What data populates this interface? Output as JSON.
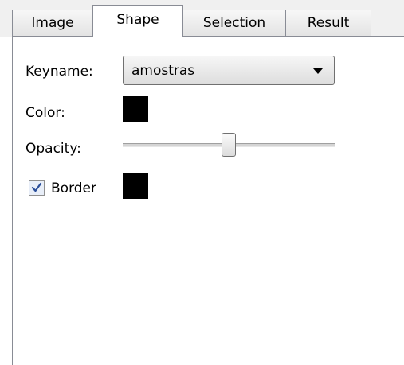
{
  "tabs": [
    {
      "label": "Image"
    },
    {
      "label": "Shape"
    },
    {
      "label": "Selection"
    },
    {
      "label": "Result"
    }
  ],
  "active_tab": "Shape",
  "form": {
    "keyname_label": "Keyname:",
    "keyname_value": "amostras",
    "color_label": "Color:",
    "color_value": "#000000",
    "opacity_label": "Opacity:",
    "opacity_fraction": 0.5,
    "border_label": "Border",
    "border_checked": true,
    "border_color": "#000000"
  },
  "icons": {
    "combo_arrow": "chevron-down-icon",
    "checkbox_mark": "check-icon"
  }
}
